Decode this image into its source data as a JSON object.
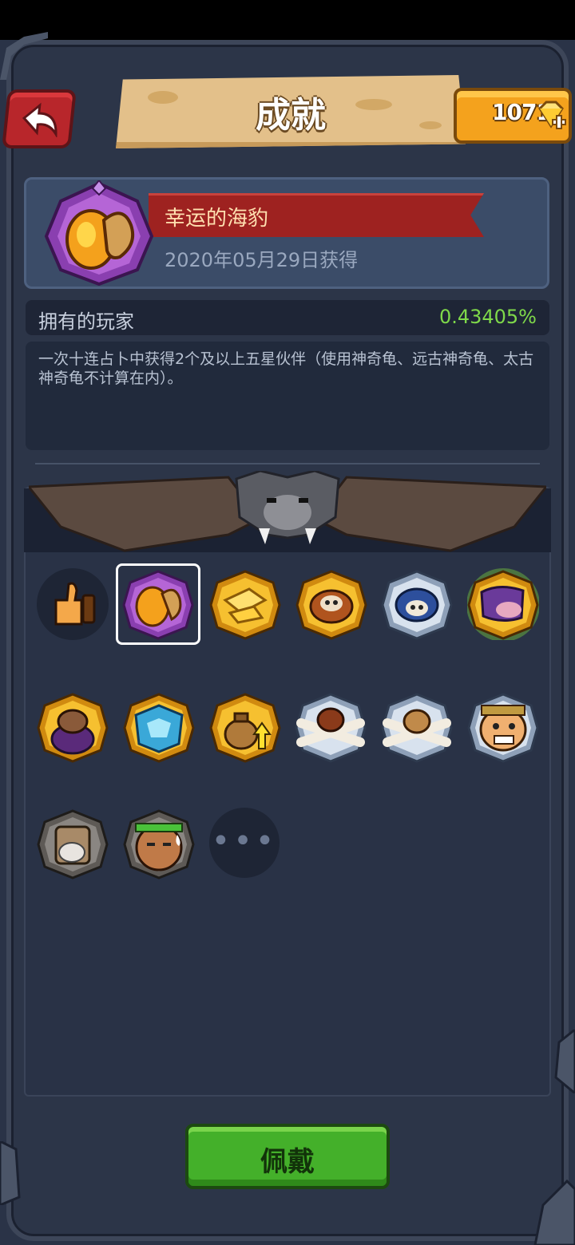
{
  "header": {
    "title": "成就",
    "gem_count": "1071"
  },
  "achievement": {
    "name": "幸运的海豹",
    "date": "2020年05月29日获得",
    "owner_label": "拥有的玩家",
    "owner_percent": "0.43405%",
    "description": "一次十连占卜中获得2个及以上五星伙伴（使用神奇龟、远古神奇龟、太古神奇龟不计算在内）。"
  },
  "badges": [
    {
      "icon": "thumbs-up-icon",
      "frame": "dark"
    },
    {
      "icon": "lucky-seal-icon",
      "frame": "purple",
      "selected": true
    },
    {
      "icon": "gold-scrap-icon",
      "frame": "gold"
    },
    {
      "icon": "beast-skull-icon",
      "frame": "gold"
    },
    {
      "icon": "blue-skull-icon",
      "frame": "silver"
    },
    {
      "icon": "purple-mask-icon",
      "frame": "gold-glow"
    },
    {
      "icon": "dragon-egg-icon",
      "frame": "gold"
    },
    {
      "icon": "ice-beast-icon",
      "frame": "gold"
    },
    {
      "icon": "money-bag-up-icon",
      "frame": "gold"
    },
    {
      "icon": "eagle-bones-icon",
      "frame": "silver"
    },
    {
      "icon": "sack-bones-icon",
      "frame": "silver"
    },
    {
      "icon": "screaming-face-icon",
      "frame": "silver"
    },
    {
      "icon": "sheep-pack-icon",
      "frame": "stone"
    },
    {
      "icon": "sweating-warrior-icon",
      "frame": "stone"
    }
  ],
  "more_label": "•••",
  "wear_button": "佩戴",
  "colors": {
    "background": "#2a3347",
    "ribbon": "#9e2220",
    "percent": "#7fd94a",
    "wear_button": "#44b02a",
    "gem_box": "#f4a21d"
  }
}
